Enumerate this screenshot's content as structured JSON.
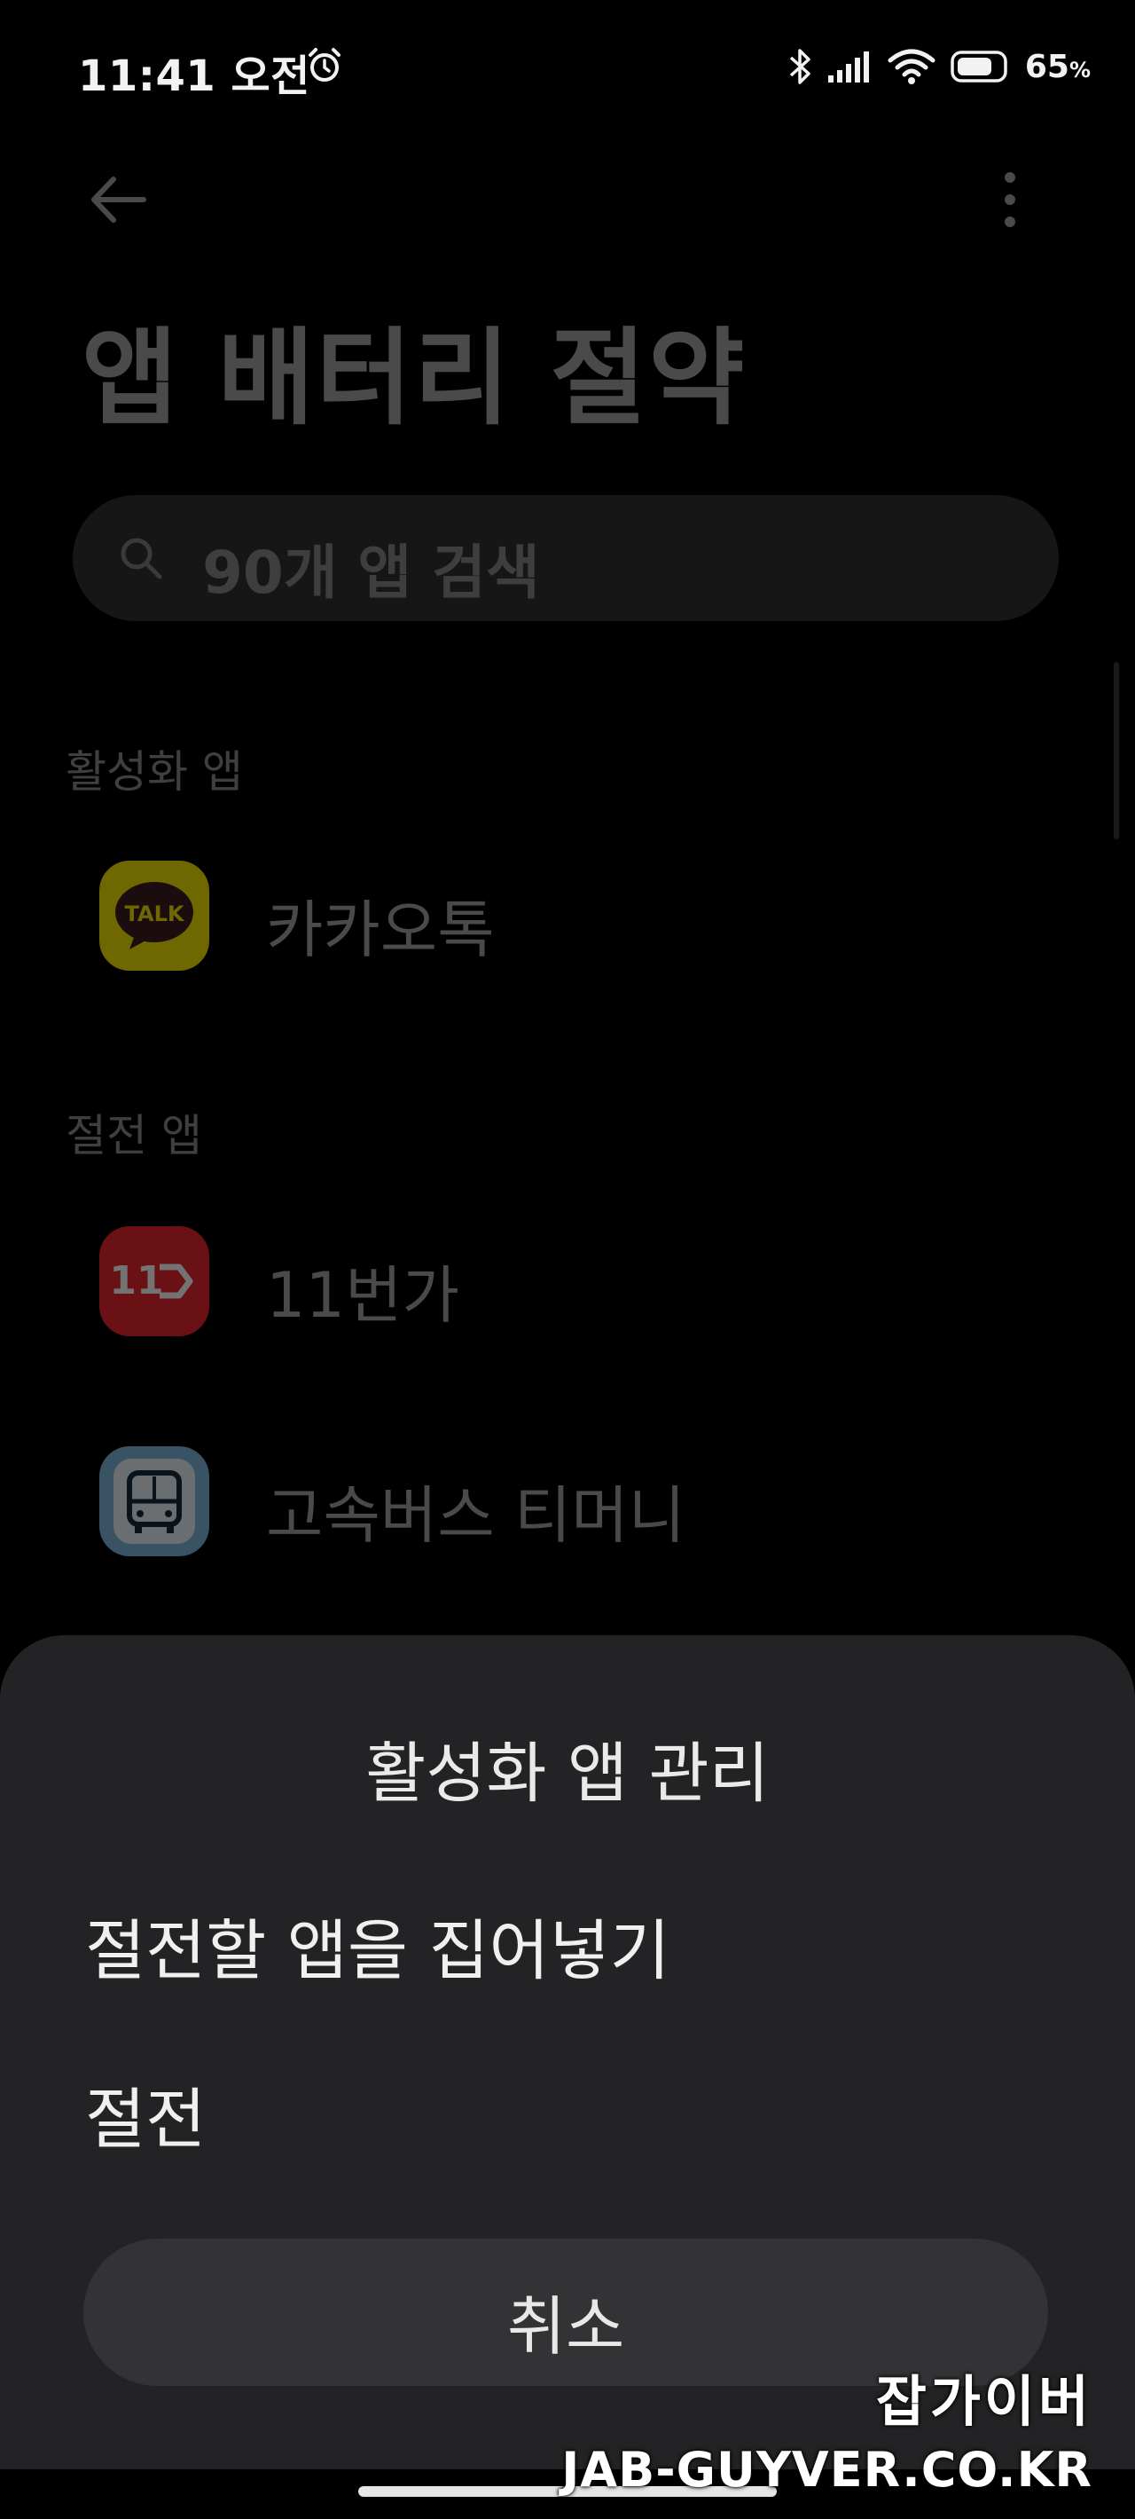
{
  "status_bar": {
    "time": "11:41 오전",
    "battery_percent": "65",
    "battery_unit": "%",
    "icons": [
      "alarm-icon",
      "bluetooth-icon",
      "signal-icon",
      "wifi-icon",
      "battery-icon"
    ]
  },
  "header": {
    "title": "앱 배터리 절약",
    "back_icon": "back-arrow-icon",
    "more_icon": "more-vertical-icon"
  },
  "search": {
    "placeholder": "90개 앱 검색"
  },
  "sections": {
    "active_header": "활성화 앱",
    "saving_header": "절전 앱"
  },
  "apps": {
    "active": [
      {
        "name": "카카오톡",
        "icon": "kakaotalk-icon",
        "icon_text": "TALK",
        "icon_color": "#f7e600"
      }
    ],
    "saving": [
      {
        "name": "11번가",
        "icon": "11st-icon",
        "icon_text": "11",
        "icon_color": "#e8262d"
      },
      {
        "name": "고속버스 티머니",
        "icon": "bus-icon",
        "icon_color": "#eaf4fb"
      }
    ]
  },
  "sheet": {
    "title": "활성화 앱 관리",
    "options": [
      "절전할 앱을 집어넣기",
      "절전"
    ],
    "cancel_label": "취소"
  },
  "watermark": {
    "korean": "잡가이버",
    "english": "JAB-GUYVER.CO.KR"
  },
  "colors": {
    "background": "#000000",
    "sheet": "#232325",
    "cancel_button": "#333336"
  }
}
